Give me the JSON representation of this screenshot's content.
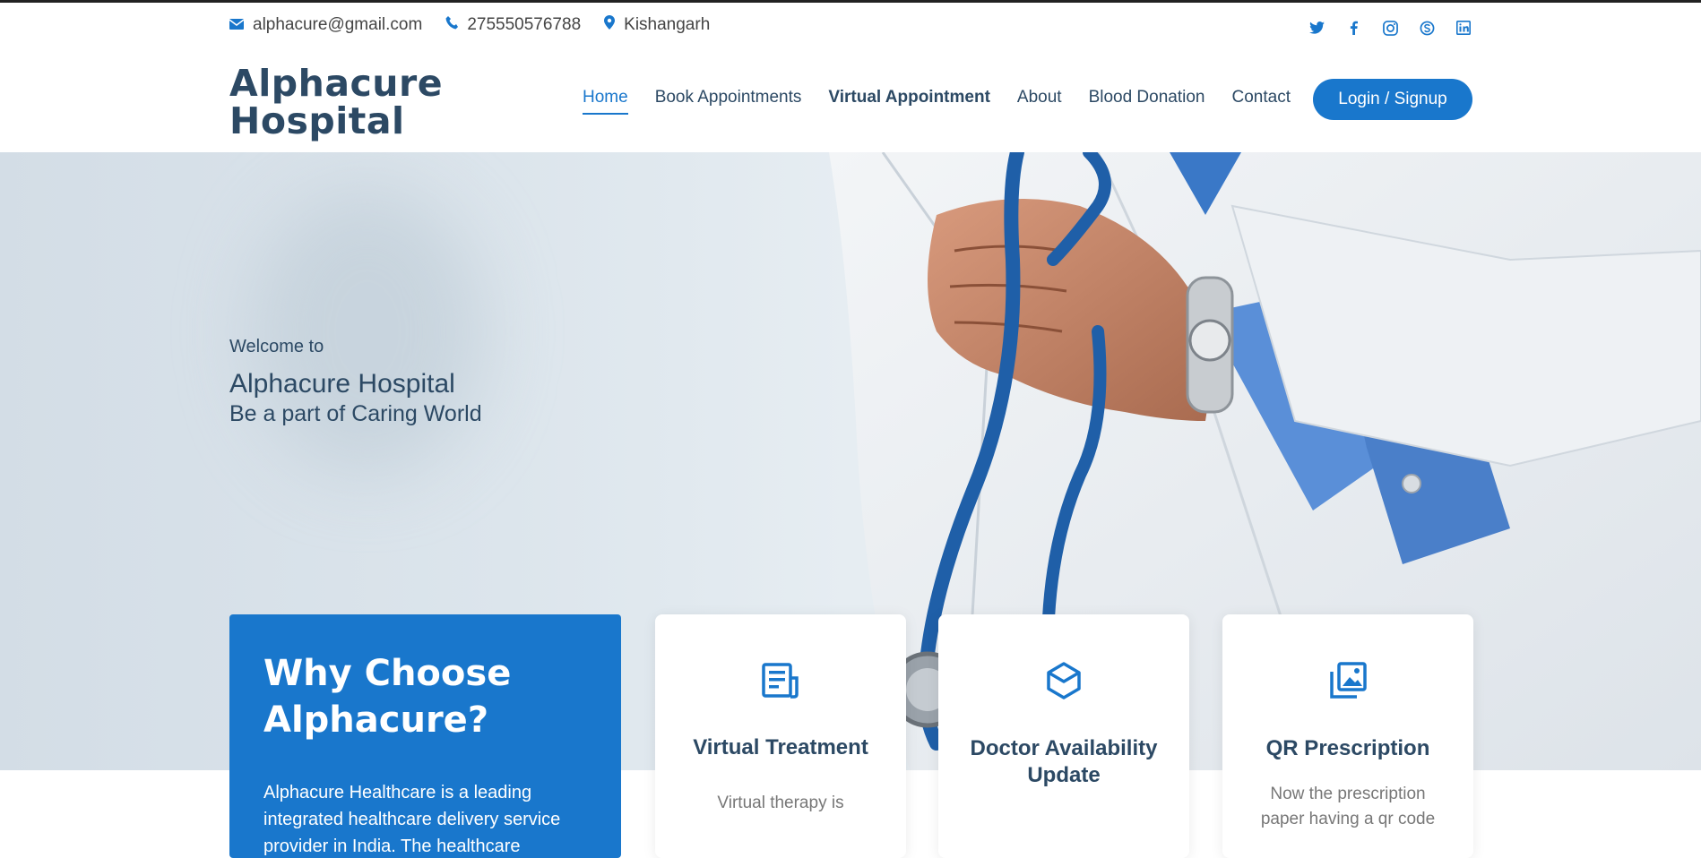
{
  "topbar": {
    "email": "alphacure@gmail.com",
    "phone": "275550576788",
    "location": "Kishangarh",
    "social": [
      "twitter-icon",
      "facebook-icon",
      "instagram-icon",
      "skype-icon",
      "linkedin-icon"
    ]
  },
  "header": {
    "logo_line1": "Alphacure",
    "logo_line2": "Hospital",
    "nav": [
      "Home",
      "Book Appointments",
      "Virtual Appointment",
      "About",
      "Blood Donation",
      "Contact"
    ],
    "login": "Login / Signup"
  },
  "hero": {
    "welcome": "Welcome to",
    "title": "Alphacure Hospital",
    "tagline": "Be a part of Caring World"
  },
  "why": {
    "title": "Why Choose Alphacure?",
    "text": "Alphacure Healthcare is a leading integrated healthcare delivery service provider in India. The healthcare"
  },
  "cards": [
    {
      "icon": "document-icon",
      "title": "Virtual Treatment",
      "text": "Virtual therapy is"
    },
    {
      "icon": "cube-icon",
      "title": "Doctor Availability Update",
      "text": ""
    },
    {
      "icon": "image-gallery-icon",
      "title": "QR Prescription",
      "text": "Now the prescription paper having a qr code"
    }
  ],
  "colors": {
    "primary": "#1977cc",
    "heading": "#2c4964"
  }
}
